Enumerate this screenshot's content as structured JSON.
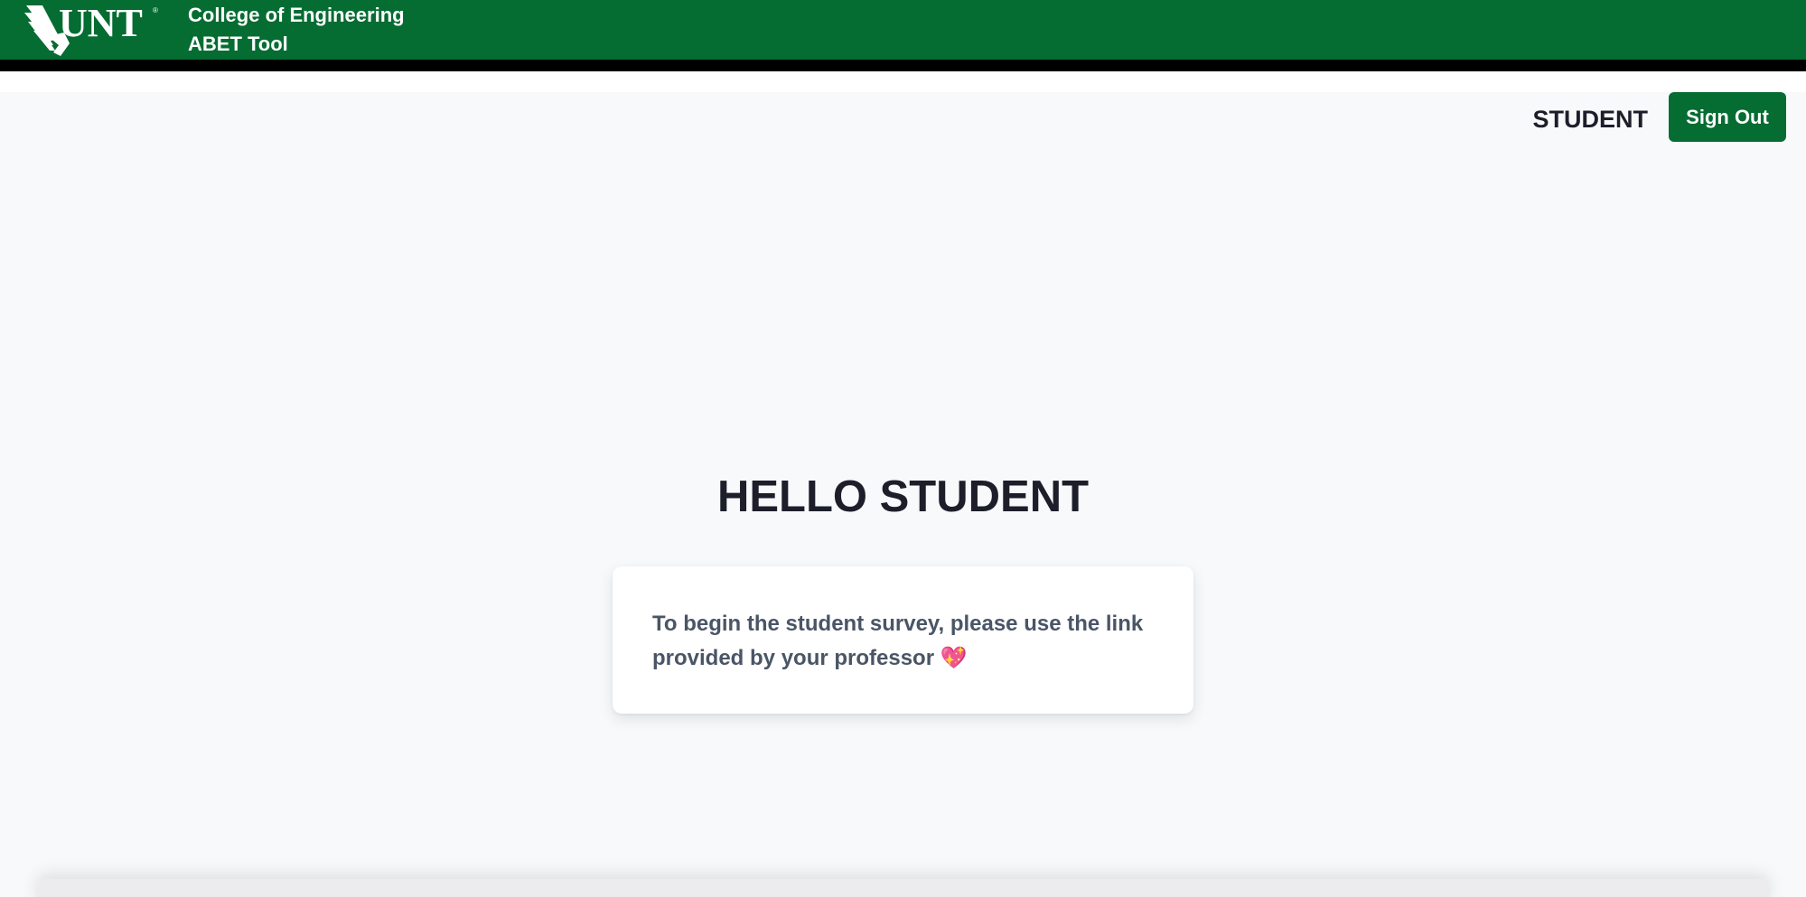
{
  "header": {
    "logo_text": "UNT",
    "college": "College of Engineering",
    "tool": "ABET Tool",
    "brand_color": "#056c32"
  },
  "user_bar": {
    "role": "STUDENT",
    "sign_out_label": "Sign Out"
  },
  "main": {
    "greeting": "HELLO STUDENT",
    "survey_message": "To begin the student survey, please use the link provided by your professor",
    "emoji": "💖"
  }
}
